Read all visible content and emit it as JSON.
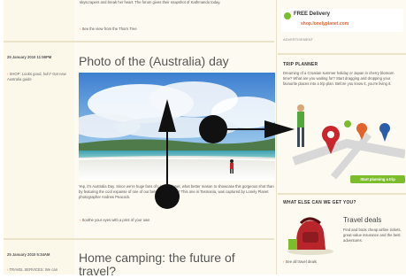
{
  "top_post": {
    "snippet": "skyscrapers and break her heart. The forum gives their snapshot of Kathmandu today.",
    "link_text": "See the view from the Thorn Tree"
  },
  "post1": {
    "date": "25 January 2010 11:59PM",
    "sidebar_note": "SHOP: Looks good, huh? Get new Australia guide",
    "title": "Photo of the (Australia) day",
    "body": "Yep, it's Australia Day. Since we're huge fans of Lonely Planet, what better reason to showcase this gorgeous shot than by featuring the cool expanse of one of our beloved beaches? This one in Tasmania, was captured by Lonely Planet photographer Andrew Peacock.",
    "more_link": "Soothe your eyes with a print of your own"
  },
  "post2": {
    "date": "25 January 2010 5:34AM",
    "sidebar_note": "TRAVEL SERVICES: We can",
    "title": "Home camping: the future of travel?"
  },
  "ad": {
    "free_delivery": "FREE Delivery",
    "shop_url": "shop.lonelyplanet.com",
    "label": "ADVERTISEMENT"
  },
  "trip_planner": {
    "heading": "TRIP PLANNER",
    "text": "Dreaming of a Croatian summer holiday or Japan in cherry blossom time? What are you waiting for? Start dragging and dropping your favourite places into a trip plan. Before you know it, you're living it.",
    "button": "Start planning a trip"
  },
  "what_else": {
    "heading": "WHAT ELSE CAN WE GET YOU?",
    "deals_title": "Travel deals",
    "deals_text": "Find and book cheap airline tickets, great-value insurance and the best adventures.",
    "see_all": "See all travel deals"
  },
  "gesture": {
    "description_icons": [
      "swipe-up-arrow",
      "swipe-right-arrow"
    ]
  }
}
